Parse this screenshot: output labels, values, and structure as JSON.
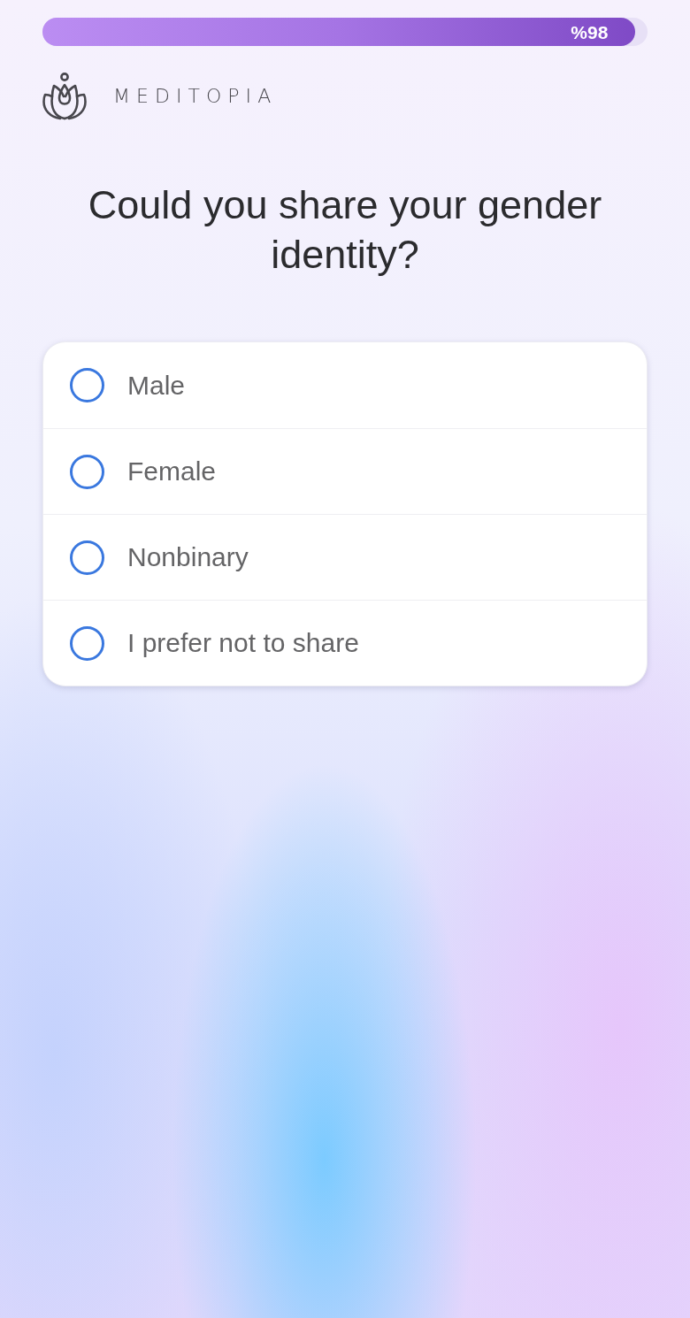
{
  "progress": {
    "level": 0.98,
    "label": "%98"
  },
  "brand": {
    "name": "MEDITOPIA"
  },
  "question": "Could you share your gender identity?",
  "options": [
    {
      "label": "Male",
      "selected": false
    },
    {
      "label": "Female",
      "selected": false
    },
    {
      "label": "Nonbinary",
      "selected": false
    },
    {
      "label": "I prefer not to share",
      "selected": false
    }
  ]
}
